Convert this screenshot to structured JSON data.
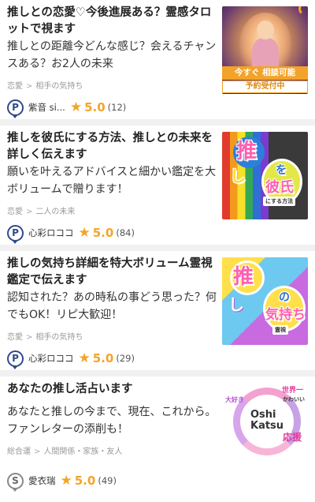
{
  "items": [
    {
      "title": "推しとの恋愛♡今後進展ある？霊感タロットで視ます",
      "desc": "推しとの距離今どんな感じ？会えるチャンスある？お2人の未来",
      "crumb_parent": "恋愛",
      "crumb_sep": ">",
      "crumb_child": "相手の気持ち",
      "seller_rank_icon": "rank-p-icon",
      "seller_rank": "P",
      "seller": "紫音 si...",
      "rating": "5.0",
      "reviews": "(12)",
      "thumb_banner": "今すぐ 相談可能",
      "thumb_badge": "予約受付中"
    },
    {
      "title": "推しを彼氏にする方法、推しとの未来を詳しく伝えます",
      "desc": "願いを叶えるアドバイスと細かい鑑定を大ボリュームで贈ります！",
      "crumb_parent": "恋愛",
      "crumb_sep": ">",
      "crumb_child": "二人の未来",
      "seller_rank_icon": "rank-p-icon",
      "seller_rank": "P",
      "seller": "心彩ロココ",
      "rating": "5.0",
      "reviews": "(84)",
      "thumb_words": [
        "推",
        "し",
        "を",
        "彼氏",
        "にする方法"
      ]
    },
    {
      "title": "推しの気持ち詳細を特大ボリューム霊視鑑定で伝えます",
      "desc": "認知された？あの時私の事どう思った？何でもOK！リピ大歓迎！",
      "crumb_parent": "恋愛",
      "crumb_sep": ">",
      "crumb_child": "相手の気持ち",
      "seller_rank_icon": "rank-p-icon",
      "seller_rank": "P",
      "seller": "心彩ロココ",
      "rating": "5.0",
      "reviews": "(29)",
      "thumb_words": [
        "推",
        "し",
        "の",
        "気持ち",
        "霊視"
      ]
    },
    {
      "title": "あなたの推し活占います",
      "desc": "あなたと推しの今まで、現在、これから。ファンレターの添削も！",
      "crumb_parent": "総合運",
      "crumb_sep": ">",
      "crumb_child": "人間関係・家族・友人",
      "seller_rank_icon": "rank-s-icon",
      "seller_rank": "S",
      "seller": "愛衣瑞",
      "rating": "5.0",
      "reviews": "(49)",
      "thumb_words": [
        "Oshi",
        "Katsu",
        "世界一",
        "かわいい",
        "大好き",
        "応援"
      ]
    }
  ],
  "colors": {
    "star": "#f2a52b",
    "rank_p": "#2f4a8c",
    "rank_s": "#888888",
    "banner": "#f3a32a"
  },
  "icons": {
    "star": "star-icon"
  }
}
